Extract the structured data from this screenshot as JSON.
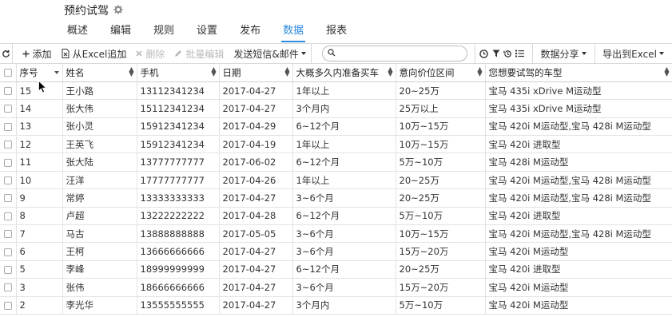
{
  "header": {
    "title": "预约试驾"
  },
  "tabs": [
    {
      "label": "概述"
    },
    {
      "label": "编辑"
    },
    {
      "label": "规则"
    },
    {
      "label": "设置"
    },
    {
      "label": "发布"
    },
    {
      "label": "数据",
      "active": true
    },
    {
      "label": "报表"
    }
  ],
  "toolbar": {
    "add": "添加",
    "import_excel": "从Excel追加",
    "delete": "删除",
    "batch_edit": "批量编辑",
    "send": "发送短信&邮件",
    "search_placeholder": "",
    "data_share": "数据分享",
    "export": "导出到Excel"
  },
  "table": {
    "columns": [
      "序号",
      "姓名",
      "手机",
      "日期",
      "大概多久内准备买车",
      "意向价位区间",
      "您想要试驾的车型"
    ],
    "rows": [
      [
        "15",
        "王小路",
        "13112341234",
        "2017-04-27",
        "1年以上",
        "20~25万",
        "宝马 435i xDrive M运动型"
      ],
      [
        "14",
        "张大伟",
        "15112341234",
        "2017-04-27",
        "3个月内",
        "25万以上",
        "宝马 435i xDrive M运动型"
      ],
      [
        "13",
        "张小灵",
        "15912341234",
        "2017-04-29",
        "6~12个月",
        "10万~15万",
        "宝马 420i M运动型,宝马 428i M运动型"
      ],
      [
        "12",
        "王英飞",
        "15912341234",
        "2017-04-19",
        "1年以上",
        "10万~15万",
        "宝马 420i 进取型"
      ],
      [
        "11",
        "张大陆",
        "13777777777",
        "2017-06-02",
        "6~12个月",
        "5万~10万",
        "宝马 428i M运动型"
      ],
      [
        "10",
        "汪洋",
        "17777777777",
        "2017-04-26",
        "1年以上",
        "20~25万",
        "宝马 420i M运动型,宝马 428i M运动型"
      ],
      [
        "9",
        "常婷",
        "13333333333",
        "2017-04-27",
        "3~6个月",
        "20~25万",
        "宝马 420i M运动型,宝马 428i M运动型"
      ],
      [
        "8",
        "卢超",
        "13222222222",
        "2017-04-28",
        "6~12个月",
        "5万~10万",
        "宝马 420i 进取型"
      ],
      [
        "7",
        "马古",
        "13888888888",
        "2017-05-05",
        "3~6个月",
        "10万~15万",
        "宝马 420i M运动型,宝马 428i M运动型"
      ],
      [
        "6",
        "王柯",
        "13666666666",
        "2017-04-27",
        "3~6个月",
        "15万~20万",
        "宝马 420i M运动型"
      ],
      [
        "5",
        "李峰",
        "18999999999",
        "2017-04-27",
        "6~12个月",
        "20~25万",
        "宝马 420i 进取型"
      ],
      [
        "3",
        "张伟",
        "18666666666",
        "2017-04-27",
        "3~6个月",
        "15万~20万",
        "宝马 420i M运动型"
      ],
      [
        "2",
        "李光华",
        "13555555555",
        "2017-04-27",
        "3个月内",
        "5万~10万",
        "宝马 420i M运动型"
      ]
    ]
  },
  "colors": {
    "accent": "#2b8ae0",
    "border": "#e3e3e3"
  }
}
